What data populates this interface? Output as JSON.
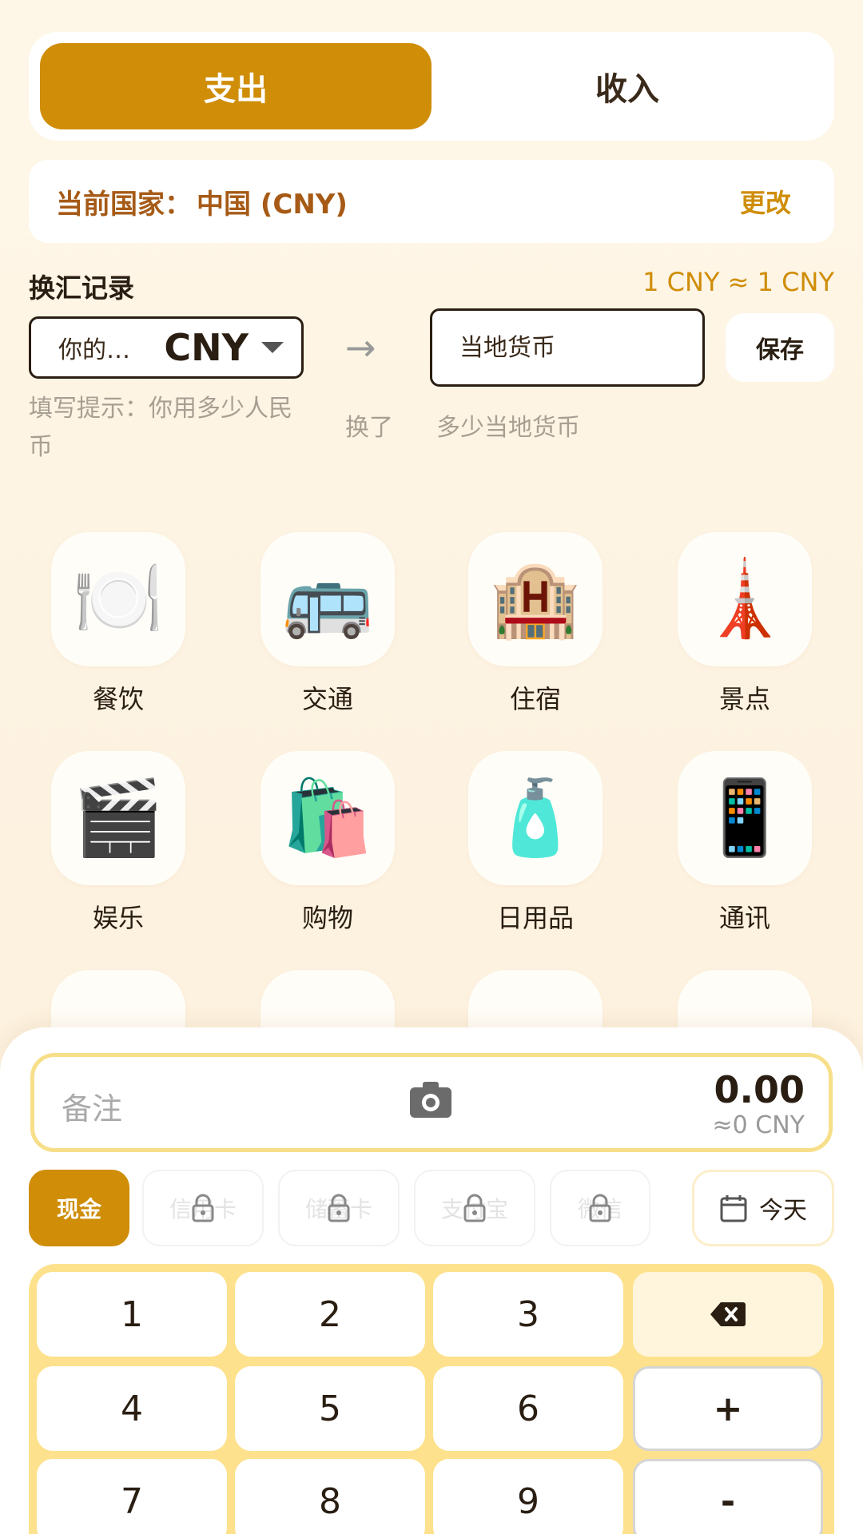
{
  "type_toggle": {
    "expense": "支出",
    "income": "收入"
  },
  "country": {
    "label": "当前国家：",
    "value": "中国 (CNY)",
    "change": "更改"
  },
  "exchange": {
    "title": "换汇记录",
    "rate": "1 CNY ≈ 1 CNY",
    "select_placeholder": "你的…",
    "select_currency": "CNY",
    "local_placeholder": "当地货币",
    "save": "保存",
    "hint_left": "填写提示：你用多少人民币",
    "hint_mid": "换了",
    "hint_right": "多少当地货币"
  },
  "categories": [
    {
      "label": "餐饮",
      "icon": "🍽️",
      "icon_name": "dining-icon"
    },
    {
      "label": "交通",
      "icon": "🚌",
      "icon_name": "bus-icon"
    },
    {
      "label": "住宿",
      "icon": "🏨",
      "icon_name": "hotel-icon"
    },
    {
      "label": "景点",
      "icon": "🗼",
      "icon_name": "tower-icon"
    },
    {
      "label": "娱乐",
      "icon": "🎬",
      "icon_name": "clapper-icon"
    },
    {
      "label": "购物",
      "icon": "🛍️",
      "icon_name": "shopping-bags-icon"
    },
    {
      "label": "日用品",
      "icon": "🧴",
      "icon_name": "lotion-bottle-icon"
    },
    {
      "label": "通讯",
      "icon": "📱",
      "icon_name": "phone-icon"
    }
  ],
  "entry": {
    "note_placeholder": "备注",
    "amount": "0.00",
    "approx": "≈0 CNY"
  },
  "payment": {
    "cash": "现金",
    "credit": "信用卡",
    "debit": "储蓄卡",
    "alipay": "支付宝",
    "wechat": "微信",
    "date": "今天"
  },
  "keypad": {
    "k1": "1",
    "k2": "2",
    "k3": "3",
    "k4": "4",
    "k5": "5",
    "k6": "6",
    "k7": "7",
    "k8": "8",
    "k9": "9",
    "plus": "+",
    "minus": "-"
  },
  "colors": {
    "accent": "#cf8d08",
    "keypad_bg": "#fde18c",
    "country_text": "#a65a16"
  }
}
